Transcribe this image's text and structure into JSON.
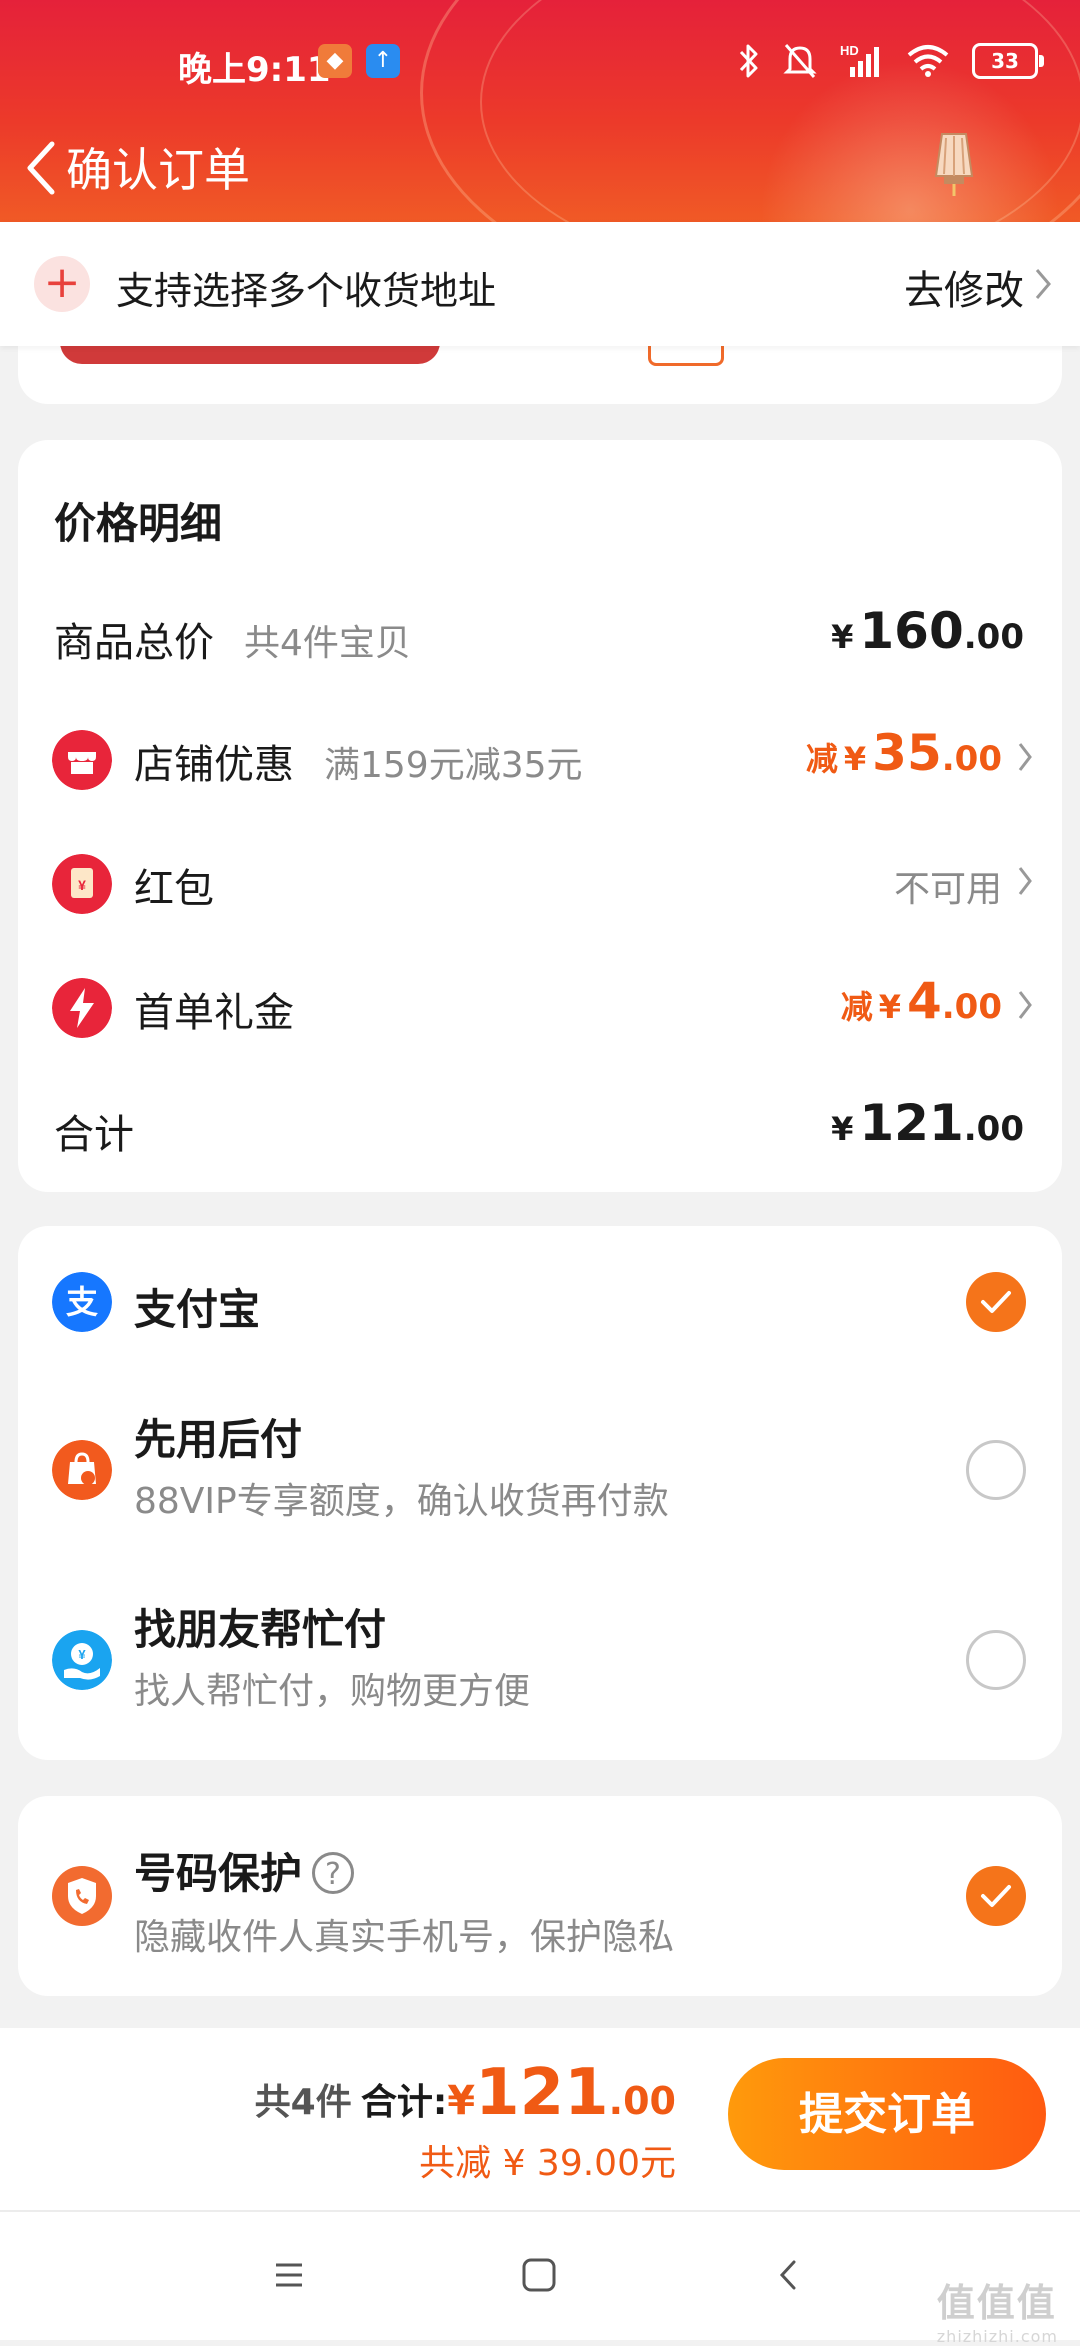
{
  "status_bar": {
    "time": "晚上9:11",
    "battery": "33",
    "network": "HD"
  },
  "header": {
    "title": "确认订单"
  },
  "notice": {
    "text": "支持选择多个收货地址",
    "link": "去修改"
  },
  "price_detail": {
    "title": "价格明细",
    "total_goods": {
      "label": "商品总价",
      "sub": "共4件宝贝",
      "yen": "¥",
      "int": "160",
      "dec": ".00"
    },
    "shop_discount": {
      "label": "店铺优惠",
      "sub": "满159元减35元",
      "minus": "减",
      "yen": "¥",
      "int": "35",
      "dec": ".00"
    },
    "red_packet": {
      "label": "红包",
      "value": "不可用"
    },
    "first_order": {
      "label": "首单礼金",
      "minus": "减",
      "yen": "¥",
      "int": "4",
      "dec": ".00"
    },
    "subtotal": {
      "label": "合计",
      "yen": "¥",
      "int": "121",
      "dec": ".00"
    }
  },
  "payment": {
    "options": [
      {
        "title": "支付宝",
        "sub": "",
        "selected": true
      },
      {
        "title": "先用后付",
        "sub": "88VIP专享额度，确认收货再付款",
        "selected": false
      },
      {
        "title": "找朋友帮忙付",
        "sub": "找人帮忙付，购物更方便",
        "selected": false
      }
    ]
  },
  "phone_protection": {
    "title": "号码保护",
    "help": "?",
    "sub": "隐藏收件人真实手机号，保护隐私",
    "selected": true
  },
  "bottom_bar": {
    "count": "共4件",
    "total_label": "合计:",
    "yen": "¥",
    "total_int": "121",
    "total_dec": ".00",
    "saved": "共减 ¥ 39.00元",
    "submit": "提交订单"
  },
  "watermark": {
    "text": "值值值",
    "url": "zhizhizhi.com"
  },
  "colors": {
    "accent": "#f05a14",
    "header_red": "#e5213a",
    "radio_selected": "#f5741a"
  }
}
